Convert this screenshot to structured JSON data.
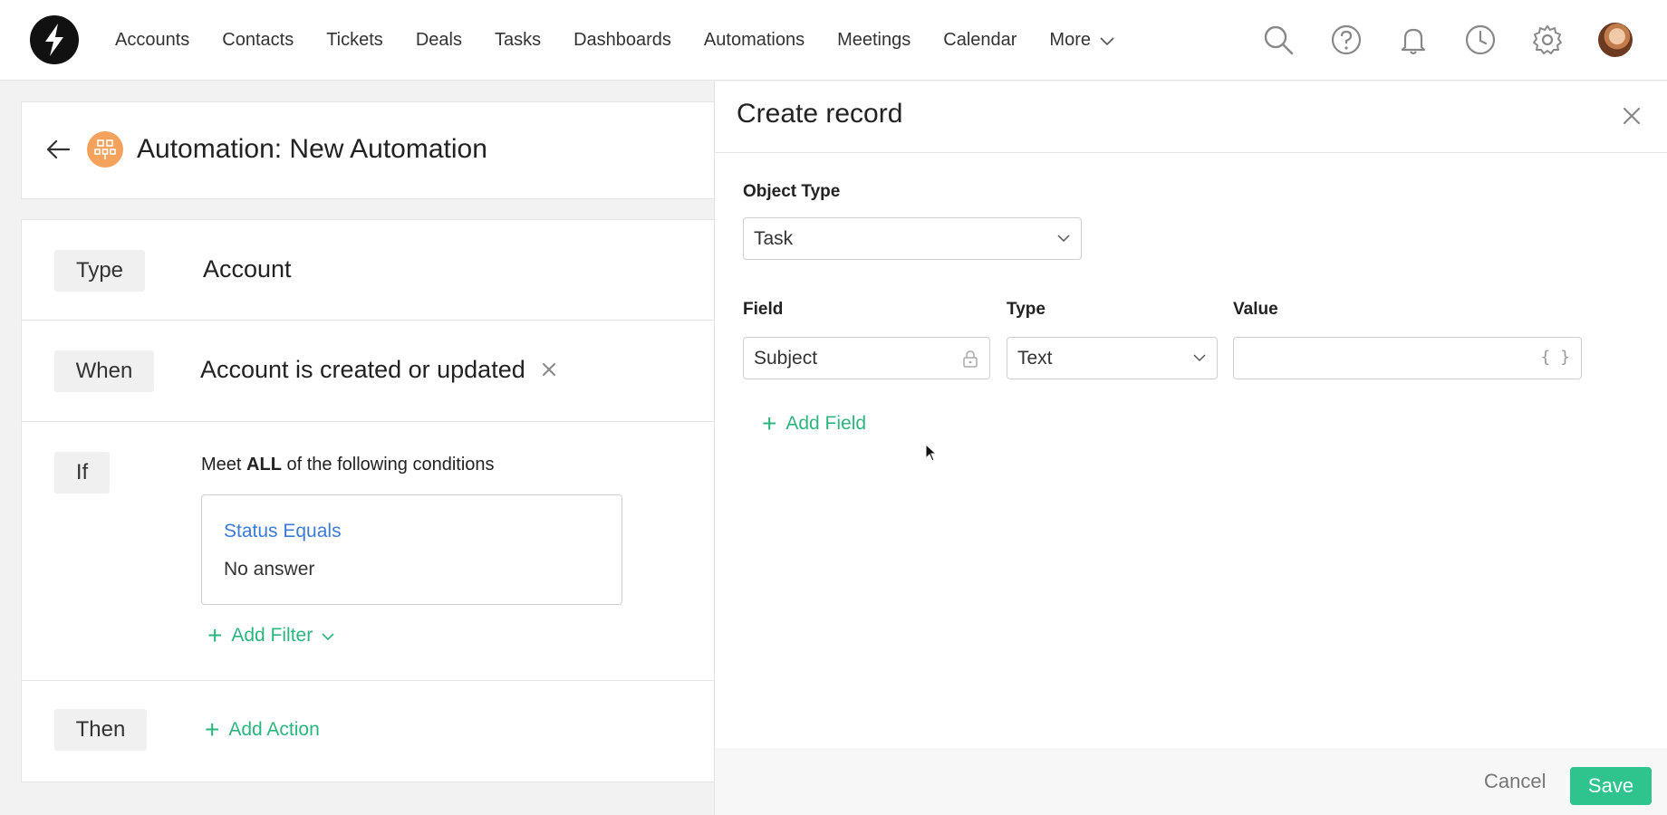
{
  "nav": {
    "items": [
      "Accounts",
      "Contacts",
      "Tickets",
      "Deals",
      "Tasks",
      "Dashboards",
      "Automations",
      "Meetings",
      "Calendar"
    ],
    "more_label": "More",
    "icons": [
      "search-icon",
      "help-icon",
      "bell-icon",
      "clock-icon",
      "gear-icon"
    ]
  },
  "automation": {
    "title": "Automation: New Automation",
    "type_label": "Type",
    "type_value": "Account",
    "when_label": "When",
    "when_value": "Account is created or updated",
    "if_label": "If",
    "meet_prefix": "Meet",
    "meet_bold": "ALL",
    "meet_suffix": "of the following conditions",
    "condition_title": "Status Equals",
    "condition_value": "No answer",
    "add_filter_label": "Add Filter",
    "then_label": "Then",
    "add_action_label": "Add Action"
  },
  "drawer": {
    "title": "Create record",
    "object_type_label": "Object Type",
    "object_type_value": "Task",
    "field_header": "Field",
    "type_header": "Type",
    "value_header": "Value",
    "field_value": "Subject",
    "type_value": "Text",
    "value_value": "",
    "value_braces": "{ }",
    "add_field_label": "Add Field",
    "cancel_label": "Cancel",
    "save_label": "Save"
  },
  "colors": {
    "accent_green": "#2fc48d",
    "link_green": "#2db57f",
    "link_blue": "#3d7ad6",
    "automation_icon": "#f5a25d"
  }
}
